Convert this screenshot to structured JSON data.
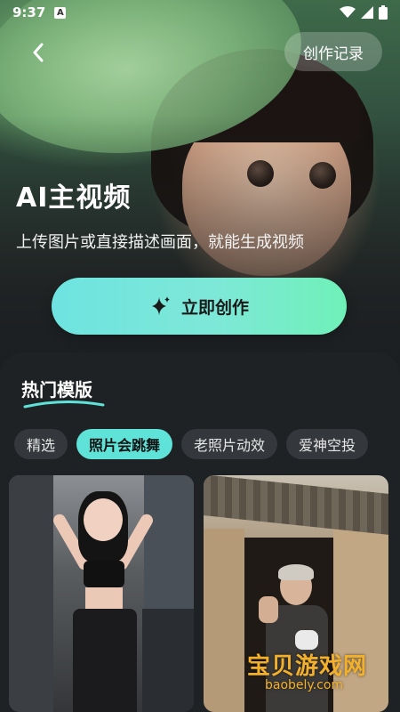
{
  "status_bar": {
    "time": "9:37",
    "notification_badge": "A"
  },
  "nav": {
    "record_label": "创作记录"
  },
  "hero": {
    "title": "AI主视频",
    "subtitle": "上传图片或直接描述画面，就能生成视频",
    "create_label": "立即创作"
  },
  "templates": {
    "section_title": "热门模版",
    "chips": [
      {
        "label": "精选",
        "active": false
      },
      {
        "label": "照片会跳舞",
        "active": true
      },
      {
        "label": "老照片动效",
        "active": false
      },
      {
        "label": "爱神空投",
        "active": false
      }
    ],
    "cards": [
      {
        "label": "dancing-girl-card"
      },
      {
        "label": "old-woman-card"
      }
    ]
  },
  "watermark": {
    "text": "宝贝游戏网",
    "url": "baobely.com"
  },
  "colors": {
    "accent": "#5fe3d8",
    "panel_bg": "#1f2225",
    "chip_bg": "#34383c"
  },
  "icons": {
    "back": "chevron-left-icon",
    "create": "sparkle-icon",
    "wifi": "wifi-icon",
    "battery": "battery-icon"
  }
}
